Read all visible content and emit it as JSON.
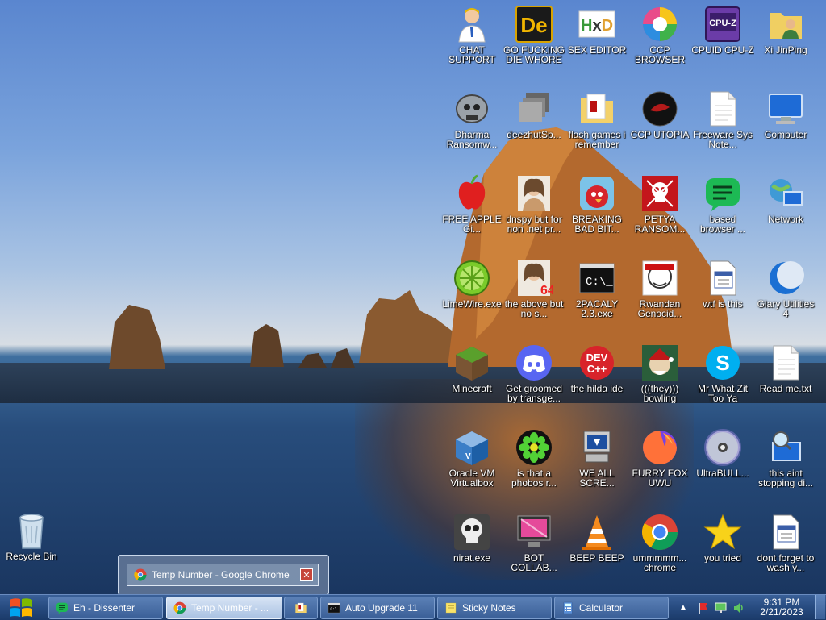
{
  "desktop_icons": [
    {
      "label": "CHAT SUPPORT",
      "icon": "support-person-icon"
    },
    {
      "label": "GO FUCKING DIE WHORE",
      "icon": "de-app-icon"
    },
    {
      "label": "SEX EDITOR",
      "icon": "hxd-hex-editor-icon"
    },
    {
      "label": "CCP BROWSER",
      "icon": "browser-color-wheel-icon"
    },
    {
      "label": "CPUID CPU-Z",
      "icon": "cpu-z-icon"
    },
    {
      "label": "Xi JinPing",
      "icon": "user-folder-icon"
    },
    {
      "label": "Dharma Ransomw...",
      "icon": "skull-helmet-icon"
    },
    {
      "label": "deezhutSp...",
      "icon": "stacked-windows-icon"
    },
    {
      "label": "flash games i remember",
      "icon": "folder-icon"
    },
    {
      "label": "CCP UTOPIA",
      "icon": "dark-circle-logo-icon"
    },
    {
      "label": "Freeware Sys Note...",
      "icon": "text-file-icon"
    },
    {
      "label": "Computer",
      "icon": "computer-icon"
    },
    {
      "label": "FREE APPLE Gi...",
      "icon": "apple-icon"
    },
    {
      "label": "dnspy but for non .net pr...",
      "icon": "portrait-icon"
    },
    {
      "label": "BREAKING BAD BIT...",
      "icon": "angry-bird-icon"
    },
    {
      "label": "PETYA RANSOM...",
      "icon": "skull-red-icon"
    },
    {
      "label": "based browser ...",
      "icon": "green-chat-icon"
    },
    {
      "label": "Network",
      "icon": "network-globe-icon"
    },
    {
      "label": "LimeWire.exe",
      "icon": "limewire-icon"
    },
    {
      "label": "the above but no s...",
      "icon": "portrait-64-icon"
    },
    {
      "label": "2PACALY 2.3.exe",
      "icon": "console-icon"
    },
    {
      "label": "Rwandan Genocid...",
      "icon": "meme-face-icon"
    },
    {
      "label": "wtf is this",
      "icon": "calendar-file-icon"
    },
    {
      "label": "Glary Utilities 4",
      "icon": "moon-logo-icon"
    },
    {
      "label": "Minecraft",
      "icon": "grass-block-icon"
    },
    {
      "label": "Get groomed by transge...",
      "icon": "discord-icon"
    },
    {
      "label": "the hilda ide",
      "icon": "dev-cpp-icon"
    },
    {
      "label": "(((they))) bowling",
      "icon": "elf-face-icon"
    },
    {
      "label": "Mr What Zit Too Ya",
      "icon": "skype-icon"
    },
    {
      "label": "Read me.txt",
      "icon": "text-file-icon"
    },
    {
      "label": "Oracle VM Virtualbox",
      "icon": "virtualbox-icon"
    },
    {
      "label": "is that a phobos r...",
      "icon": "icq-flower-icon"
    },
    {
      "label": "WE ALL SCRE...",
      "icon": "computer-screen-icon"
    },
    {
      "label": "FURRY FOX UWU",
      "icon": "firefox-icon"
    },
    {
      "label": "UltraBULL...",
      "icon": "disc-icon"
    },
    {
      "label": "this aint stopping di...",
      "icon": "search-computer-icon"
    },
    {
      "label": "nirat.exe",
      "icon": "skull-icon"
    },
    {
      "label": "BOT COLLAB...",
      "icon": "monitor-pink-icon"
    },
    {
      "label": "BEEP BEEP",
      "icon": "vlc-cone-icon"
    },
    {
      "label": "ummmmm... chrome",
      "icon": "chrome-icon"
    },
    {
      "label": "you tried",
      "icon": "star-icon"
    },
    {
      "label": "dont forget to wash y...",
      "icon": "calendar-file-icon"
    }
  ],
  "recycle_bin": {
    "label": "Recycle Bin",
    "icon": "recycle-bin-icon"
  },
  "thumbnail_preview": {
    "title": "Temp Number - Google Chrome",
    "close": "✕"
  },
  "taskbar": {
    "start_icon": "windows-logo-icon",
    "buttons": [
      {
        "label": "Eh - Dissenter",
        "icon": "green-chat-icon",
        "active": false
      },
      {
        "label": "Temp Number - ...",
        "icon": "chrome-icon",
        "active": true
      },
      {
        "label": "",
        "icon": "folder-icon",
        "active": false
      },
      {
        "label": "Auto Upgrade 11",
        "icon": "console-icon",
        "active": false
      },
      {
        "label": "Sticky Notes",
        "icon": "sticky-notes-icon",
        "active": false
      },
      {
        "label": "Calculator",
        "icon": "calculator-icon",
        "active": false
      }
    ],
    "clock": {
      "time": "9:31 PM",
      "date": "2/21/2023"
    },
    "tray_icons": [
      "arrow-up-icon",
      "flag-icon",
      "network-tray-icon",
      "volume-icon"
    ]
  },
  "colors": {
    "taskbar": "#274b80",
    "accent": "#4a74b0"
  }
}
